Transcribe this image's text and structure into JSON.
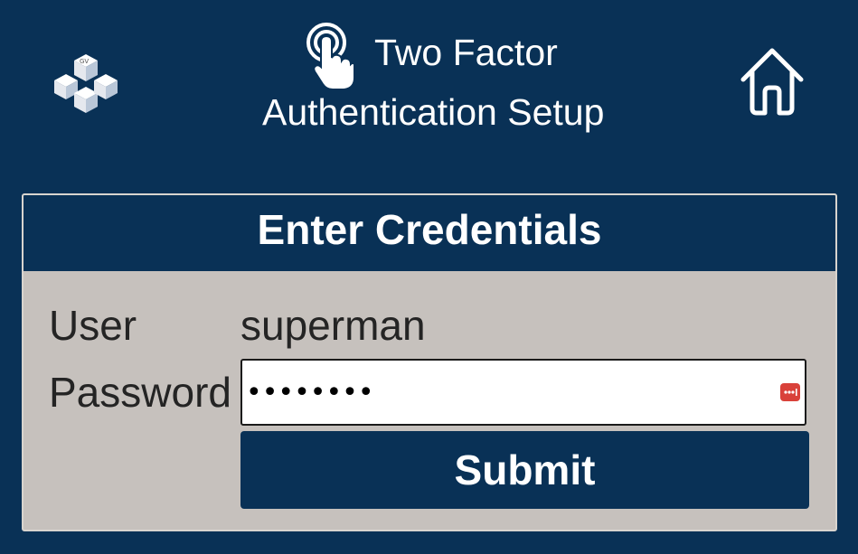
{
  "header": {
    "title_line1": "Two Factor",
    "title_line2": "Authentication Setup",
    "logo_icon": "cubes-logo-icon",
    "touch_icon": "touch-finger-icon",
    "home_icon": "home-icon"
  },
  "form": {
    "heading": "Enter Credentials",
    "user_label": "User",
    "user_value": "superman",
    "password_label": "Password",
    "password_value": "••••••••",
    "password_manager_icon": "password-key-icon",
    "submit_label": "Submit"
  },
  "colors": {
    "navy": "#093156",
    "panel": "#c6c1bd",
    "text": "#242424",
    "accent_red": "#d9413a"
  }
}
